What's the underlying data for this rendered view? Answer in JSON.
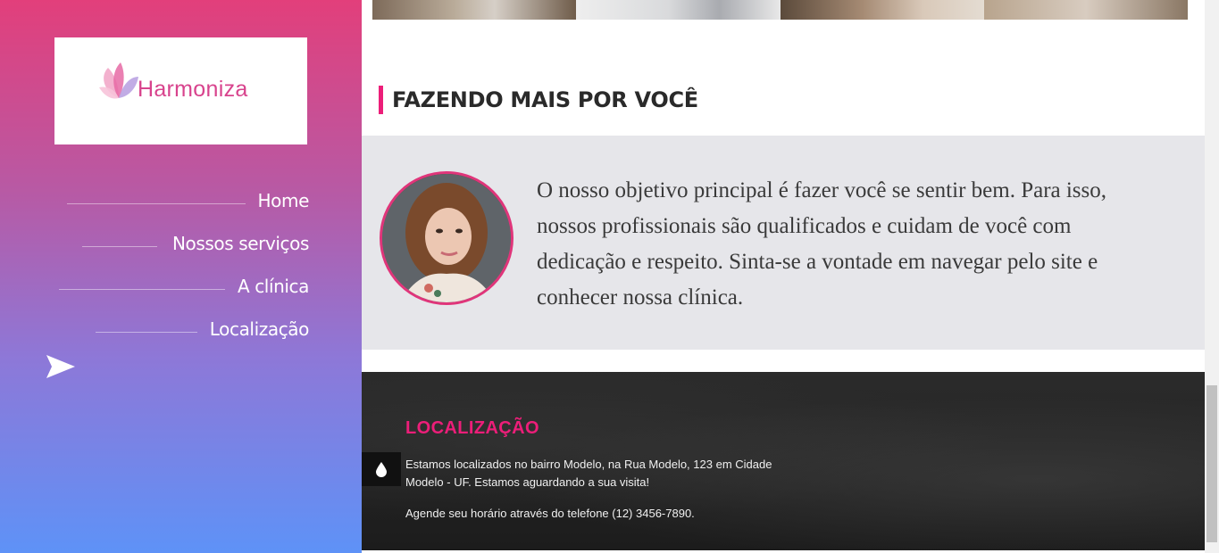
{
  "logo": {
    "text": "Harmoniza"
  },
  "nav": {
    "items": [
      {
        "label": "Home"
      },
      {
        "label": "Nossos serviços"
      },
      {
        "label": "A clínica"
      },
      {
        "label": "Localização"
      }
    ]
  },
  "section": {
    "title": "FAZENDO MAIS POR VOCÊ"
  },
  "about": {
    "text": "O nosso objetivo principal é fazer você se sentir bem. Para isso, nossos profissionais são qualificados e cuidam de você com dedicação e respeito. Sinta-se a vontade em navegar pelo site e conhecer nossa clínica."
  },
  "footer": {
    "title": "LOCALIZAÇÃO",
    "address": "Estamos localizados no bairro Modelo, na Rua Modelo, 123 em Cidade Modelo - UF. Estamos aguardando a sua visita!",
    "phone": "Agende seu horário através do telefone (12) 3456-7890."
  },
  "colors": {
    "accent": "#ec1e79",
    "footer_bg": "#222222",
    "about_bg": "#e6e6ea"
  },
  "icons": {
    "send": "send-icon",
    "drop": "drop-icon"
  }
}
